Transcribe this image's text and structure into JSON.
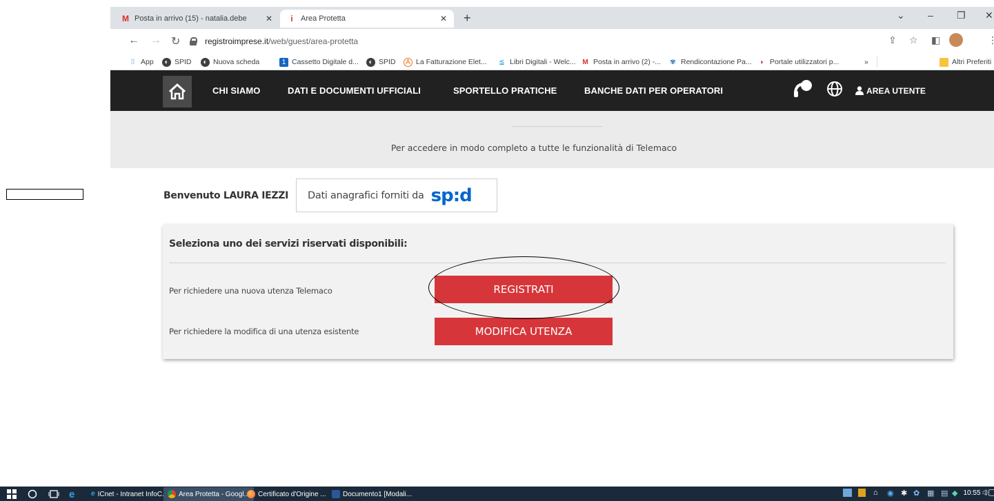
{
  "browser": {
    "tabs": [
      {
        "title": "Posta in arrivo (15) - natalia.debe",
        "icon": "gmail-icon",
        "active": false
      },
      {
        "title": "Area Protetta",
        "icon": "infocamere-icon",
        "active": true
      }
    ],
    "new_tab_symbol": "+",
    "url_host": "registroimprese.it",
    "url_path": "/web/guest/area-protetta",
    "bookmarks": [
      {
        "label": "App",
        "icon": "apps-grid-icon"
      },
      {
        "label": "SPID",
        "icon": "globe-icon"
      },
      {
        "label": "Nuova scheda",
        "icon": "globe-icon"
      },
      {
        "label": "Cassetto Digitale d...",
        "icon": "cassetto-icon"
      },
      {
        "label": "SPID",
        "icon": "globe-icon"
      },
      {
        "label": "La Fatturazione Elet...",
        "icon": "fatturazione-icon"
      },
      {
        "label": "Libri Digitali - Welc...",
        "icon": "libri-icon"
      },
      {
        "label": "Posta in arrivo (2) -...",
        "icon": "gmail-icon"
      },
      {
        "label": "Rendicontazione Pa...",
        "icon": "rendicontazione-icon"
      },
      {
        "label": "Portale utilizzatori p...",
        "icon": "portale-icon"
      }
    ],
    "bookmarks_overflow": "»",
    "other_bookmarks": "Altri Preferiti"
  },
  "site_nav": {
    "items": [
      "CHI SIAMO",
      "DATI E DOCUMENTI UFFICIALI",
      "SPORTELLO PRATICHE",
      "BANCHE DATI PER OPERATORI"
    ],
    "user_area": "AREA UTENTE"
  },
  "hero": {
    "text": "Per accedere in modo completo a tutte le funzionalità di Telemaco"
  },
  "welcome": {
    "text": "Benvenuto LAURA IEZZI",
    "spid_label": "Dati anagrafici forniti da",
    "spid_logo": "sp:d"
  },
  "services": {
    "title": "Seleziona uno dei servizi riservati disponibili:",
    "rows": [
      {
        "text": "Per richiedere una nuova utenza Telemaco",
        "button": "REGISTRATI"
      },
      {
        "text": "Per richiedere la modifica di una utenza esistente",
        "button": "MODIFICA UTENZA"
      }
    ]
  },
  "taskbar": {
    "apps": [
      {
        "label": "ICnet - Intranet InfoC...",
        "icon": "ie-icon"
      },
      {
        "label": "Area Protetta - Googl...",
        "icon": "chrome-icon"
      },
      {
        "label": "Certificato d'Origine ...",
        "icon": "firefox-icon"
      },
      {
        "label": "Documento1 [Modali...",
        "icon": "word-icon"
      }
    ],
    "clock": "10:55"
  },
  "colors": {
    "nav_bg": "#212121",
    "button_red": "#d6363a",
    "spid_blue": "#0066cc",
    "taskbar_bg": "#1b2a3a"
  }
}
